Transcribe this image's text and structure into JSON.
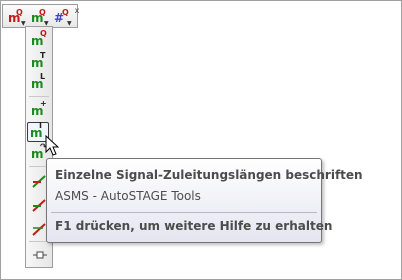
{
  "top_toolbar": {
    "buttons": [
      {
        "icon": "m-q-red-icon",
        "letter": "m",
        "sup": "Q"
      },
      {
        "icon": "m-q-green-icon",
        "letter": "m",
        "sup": "Q"
      },
      {
        "icon": "hash-q-icon",
        "letter": "#",
        "sup": "Q"
      }
    ],
    "close_label": "x"
  },
  "vertical_toolbar": {
    "buttons": [
      {
        "icon": "m-q-icon",
        "letter": "m",
        "sup": "Q"
      },
      {
        "icon": "m-t-icon",
        "letter": "m",
        "sup": "T"
      },
      {
        "icon": "m-l-icon",
        "letter": "m",
        "sup": "L"
      },
      {
        "icon": "m-plus-icon",
        "letter": "m",
        "sup": "+"
      },
      {
        "icon": "m-i-icon",
        "letter": "m",
        "sup": "I"
      },
      {
        "icon": "m-arrow-icon",
        "letter": "m",
        "sup": "↷"
      }
    ]
  },
  "tooltip": {
    "title": "Einzelne Signal-Zuleitungslängen beschriften",
    "description": "ASMS - AutoSTAGE Tools",
    "help": "F1 drücken, um weitere Hilfe zu erhalten"
  },
  "colors": {
    "green_m": "#1c8a1c",
    "red_m": "#c21c1c",
    "hash_blue": "#3c45c8"
  }
}
